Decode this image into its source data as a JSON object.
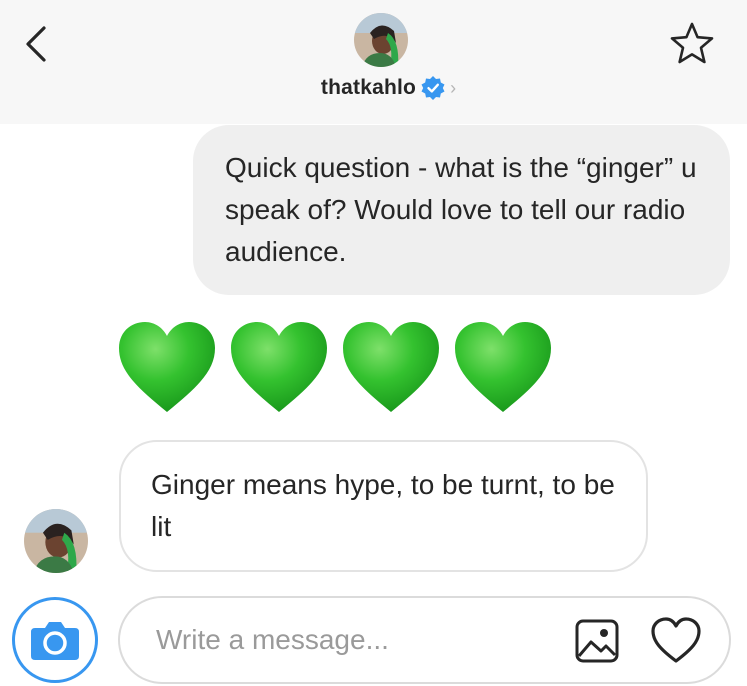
{
  "header": {
    "username": "thatkahlo",
    "chevron": "›",
    "verified_icon": "verified-badge-icon",
    "back_icon": "chevron-left-icon",
    "star_icon": "star-outline-icon"
  },
  "messages": [
    {
      "direction": "outgoing",
      "text": "Quick question - what is the “ginger” u speak of? Would love to tell our radio audience."
    },
    {
      "direction": "incoming",
      "emoji": [
        "💚",
        "💚",
        "💚",
        "💚"
      ],
      "emoji_name": "green-heart"
    },
    {
      "direction": "incoming",
      "text": "Ginger means hype, to be turnt, to be lit"
    }
  ],
  "composer": {
    "placeholder": "Write a message...",
    "camera_icon": "camera-icon",
    "gallery_icon": "gallery-icon",
    "like_icon": "heart-outline-icon"
  },
  "colors": {
    "accent": "#3897f0",
    "header_bg": "#f7f7f7",
    "outgoing_bubble": "#efefef",
    "heart_green": "#2fc12e"
  }
}
